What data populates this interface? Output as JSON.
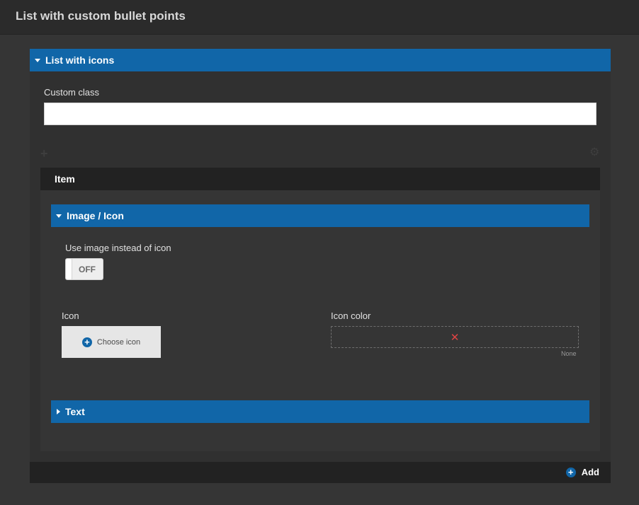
{
  "header": {
    "title": "List with custom bullet points"
  },
  "list_section": {
    "label": "List with icons",
    "custom_class": {
      "label": "Custom class",
      "value": ""
    },
    "item": {
      "title": "Item",
      "image_icon_section": {
        "label": "Image / Icon",
        "use_image_toggle": {
          "label": "Use image instead of icon",
          "state": "OFF"
        },
        "icon": {
          "label": "Icon",
          "button_label": "Choose icon"
        },
        "icon_color": {
          "label": "Icon color",
          "value_label": "None"
        }
      },
      "text_section": {
        "label": "Text"
      }
    }
  },
  "footer": {
    "add_label": "Add"
  },
  "colors": {
    "accent": "#1166a8",
    "background": "#353535",
    "dark_bar": "#222222",
    "clear_x": "#e04444"
  }
}
